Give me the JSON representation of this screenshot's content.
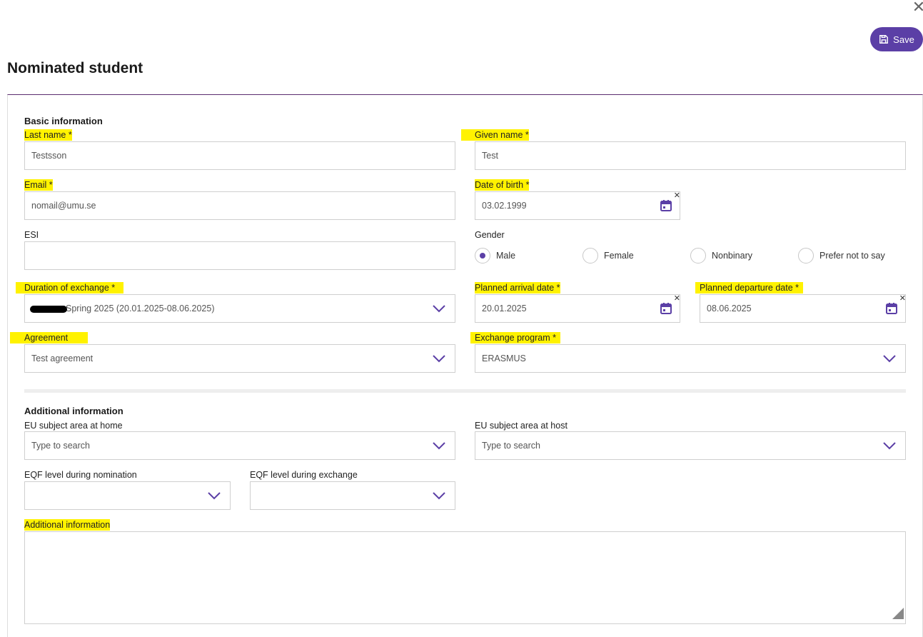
{
  "header": {
    "title": "Nominated student",
    "save_label": "Save"
  },
  "basic": {
    "section_title": "Basic information",
    "last_name_label": "Last name *",
    "last_name_value": "Testsson",
    "given_name_label": "Given name *",
    "given_name_value": "Test",
    "email_label": "Email *",
    "email_value": "nomail@umu.se",
    "dob_label": "Date of birth *",
    "dob_value": "03.02.1999",
    "esi_label": "ESI",
    "esi_value": "",
    "gender_label": "Gender",
    "gender_options": [
      "Male",
      "Female",
      "Nonbinary",
      "Prefer not to say"
    ],
    "gender_selected": "Male",
    "duration_label": "Duration of exchange *",
    "duration_value": "Spring 2025 (20.01.2025-08.06.2025)",
    "arrival_label": "Planned arrival date *",
    "arrival_value": "20.01.2025",
    "departure_label": "Planned departure date *",
    "departure_value": "08.06.2025",
    "agreement_label": "Agreement",
    "agreement_value": "Test agreement",
    "program_label": "Exchange program *",
    "program_value": "ERASMUS"
  },
  "additional": {
    "section_title": "Additional information",
    "subject_home_label": "EU subject area at home",
    "subject_home_placeholder": "Type to search",
    "subject_host_label": "EU subject area at host",
    "subject_host_placeholder": "Type to search",
    "eqf_nomination_label": "EQF level during nomination",
    "eqf_exchange_label": "EQF level during exchange",
    "info_label": "Additional information"
  },
  "icons": {
    "close": "close-icon",
    "save": "floppy-disk-icon",
    "calendar": "calendar-icon",
    "chevron": "chevron-down-icon"
  },
  "colors": {
    "accent": "#5b3fa6",
    "highlight": "#fff200"
  }
}
